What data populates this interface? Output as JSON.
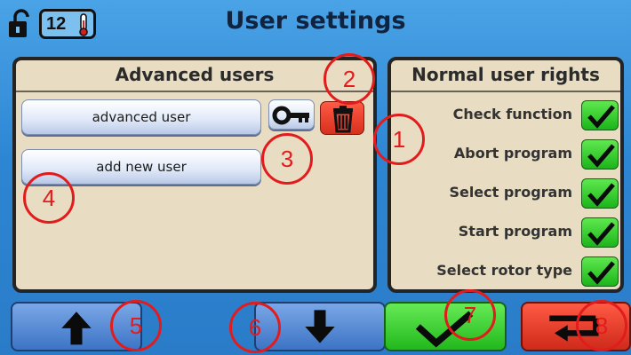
{
  "header": {
    "title": "User settings",
    "counter": "12",
    "icons": [
      "unlock-icon",
      "thermometer-icon"
    ]
  },
  "advanced_users": {
    "title": "Advanced users",
    "users": [
      {
        "label": "advanced user"
      },
      {
        "label": "add new user"
      }
    ],
    "actions": [
      "key-icon",
      "trash-icon"
    ]
  },
  "normal_user_rights": {
    "title": "Normal user rights",
    "rights": [
      {
        "label": "Check function",
        "checked": true
      },
      {
        "label": "Abort program",
        "checked": true
      },
      {
        "label": "Select program",
        "checked": true
      },
      {
        "label": "Start program",
        "checked": true
      },
      {
        "label": "Select rotor type",
        "checked": true
      }
    ]
  },
  "bottom_bar": {
    "buttons": [
      "arrow-up-icon",
      "arrow-down-icon",
      "checkmark-icon",
      "return-icon"
    ]
  },
  "annotations": [
    "1",
    "2",
    "3",
    "4",
    "5",
    "6",
    "7",
    "8"
  ],
  "colors": {
    "background": "#2d86d3",
    "panel": "#e8dcc2",
    "check_green": "#1bb51a",
    "delete_red": "#d6301e",
    "annotation_red": "#e21c1c"
  }
}
